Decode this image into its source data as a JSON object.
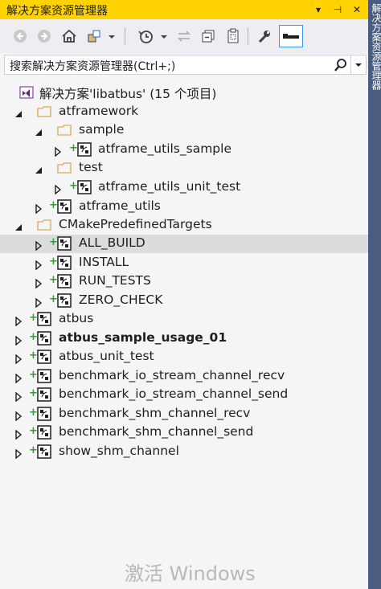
{
  "window": {
    "title": "解决方案资源管理器",
    "controls": {
      "dropdown": "▾",
      "pin": "⊣",
      "close": "✕"
    },
    "side_tab_text": "解决方案资源管理器"
  },
  "toolbar": {
    "buttons": [
      "back-icon",
      "forward-icon",
      "home-icon",
      "switch-views-icon",
      "history-icon",
      "sync-icon",
      "collapse-all-icon",
      "show-all-files-icon",
      "properties-icon",
      "preview-icon"
    ]
  },
  "search": {
    "placeholder": "搜索解决方案资源管理器(Ctrl+;)"
  },
  "tree": {
    "solution_label": "解决方案'libatbus' (15 个项目)",
    "items": [
      {
        "label": "atframework",
        "type": "folder"
      },
      {
        "label": "sample",
        "type": "folder"
      },
      {
        "label": "atframe_utils_sample",
        "type": "project"
      },
      {
        "label": "test",
        "type": "folder"
      },
      {
        "label": "atframe_utils_unit_test",
        "type": "project"
      },
      {
        "label": "atframe_utils",
        "type": "project"
      },
      {
        "label": "CMakePredefinedTargets",
        "type": "folder"
      },
      {
        "label": "ALL_BUILD",
        "type": "project",
        "selected": true
      },
      {
        "label": "INSTALL",
        "type": "project"
      },
      {
        "label": "RUN_TESTS",
        "type": "project"
      },
      {
        "label": "ZERO_CHECK",
        "type": "project"
      },
      {
        "label": "atbus",
        "type": "project"
      },
      {
        "label": "atbus_sample_usage_01",
        "type": "project",
        "bold": true
      },
      {
        "label": "atbus_unit_test",
        "type": "project"
      },
      {
        "label": "benchmark_io_stream_channel_recv",
        "type": "project"
      },
      {
        "label": "benchmark_io_stream_channel_send",
        "type": "project"
      },
      {
        "label": "benchmark_shm_channel_recv",
        "type": "project"
      },
      {
        "label": "benchmark_shm_channel_send",
        "type": "project"
      },
      {
        "label": "show_shm_channel",
        "type": "project"
      }
    ]
  },
  "watermark": "激活 Windows",
  "colors": {
    "title_bar": "#ffd200",
    "selection": "#dcdcdc",
    "side_tab": "#4a5d80",
    "folder": "#dcb67a",
    "vs_purple": "#68217a"
  }
}
